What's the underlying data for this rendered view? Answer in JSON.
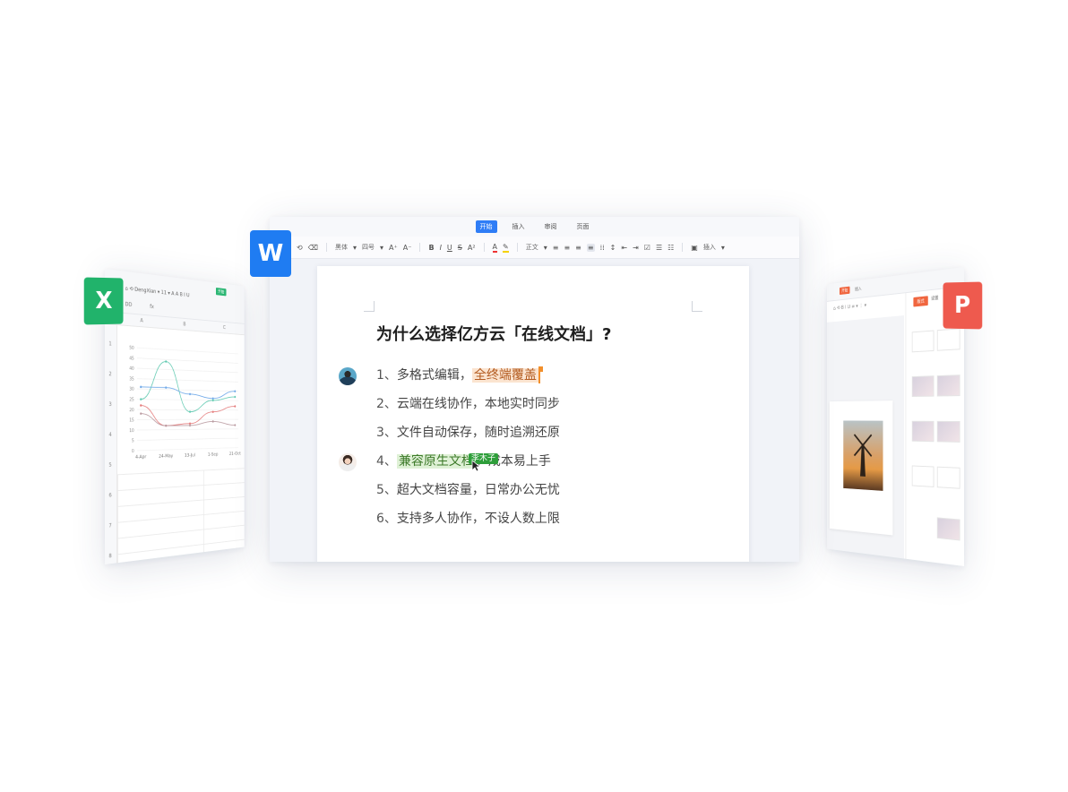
{
  "excel": {
    "badge": "X",
    "tab_start": "开始",
    "toolbar_text": "⌂  ⟲   DengXian  ▾   11  ▾   A  A   B   I   U",
    "name_box": "DD",
    "fx": "fx",
    "columns": [
      "A",
      "B",
      "C"
    ],
    "rows": [
      "1",
      "2",
      "3",
      "4",
      "5",
      "6",
      "7",
      "8"
    ],
    "colors": {
      "accent": "#2bb673",
      "badge": "#21b36b"
    }
  },
  "chart_data": {
    "type": "line",
    "x": [
      "4-Apr",
      "24-May",
      "13-Jul",
      "1-Sep",
      "21-Oct"
    ],
    "yticks": [
      0,
      5,
      10,
      15,
      20,
      25,
      30,
      35,
      40,
      45,
      50
    ],
    "ylim": [
      0,
      50
    ],
    "series": [
      {
        "values": [
          25,
          44,
          19,
          25,
          27
        ],
        "color": "#5fc9b0"
      },
      {
        "values": [
          31,
          31,
          28,
          26,
          30
        ],
        "color": "#6ea8e8"
      },
      {
        "values": [
          22,
          12,
          13,
          19,
          22
        ],
        "color": "#e47b7b"
      },
      {
        "values": [
          18,
          12,
          12,
          14,
          12
        ],
        "color": "#b99aa0"
      }
    ]
  },
  "writer": {
    "badge": "W",
    "tabs": [
      "开始",
      "插入",
      "审阅",
      "页面"
    ],
    "active_tab": 0,
    "toolbar": {
      "font": "黑体",
      "size": "四号",
      "style": "正文",
      "insert": "插入"
    },
    "colors": {
      "accent": "#2f7df6",
      "badge": "#1f7cf2"
    },
    "doc": {
      "title": "为什么选择亿方云「在线文档」?",
      "lines": [
        {
          "num": "1、",
          "text": "多格式编辑，",
          "hl": "全终端覆盖",
          "after": ""
        },
        {
          "num": "2、",
          "text": "云端在线协作，本地实时同步"
        },
        {
          "num": "3、",
          "text": "文件自动保存，随时追溯还原"
        },
        {
          "num": "4、",
          "hl": "兼容原生文档",
          "after": "，成本易上手"
        },
        {
          "num": "5、",
          "text": "超大文档容量，日常办公无忧"
        },
        {
          "num": "6、",
          "text": "支持多人协作，不设人数上限"
        }
      ],
      "collaborator_tag": "李木子"
    }
  },
  "ppt": {
    "badge": "P",
    "tab_start": "开始",
    "tab_insert": "插入",
    "side_tabs": [
      "版式",
      "设置"
    ],
    "colors": {
      "accent": "#f0663f",
      "badge": "#ee5a4e"
    }
  }
}
